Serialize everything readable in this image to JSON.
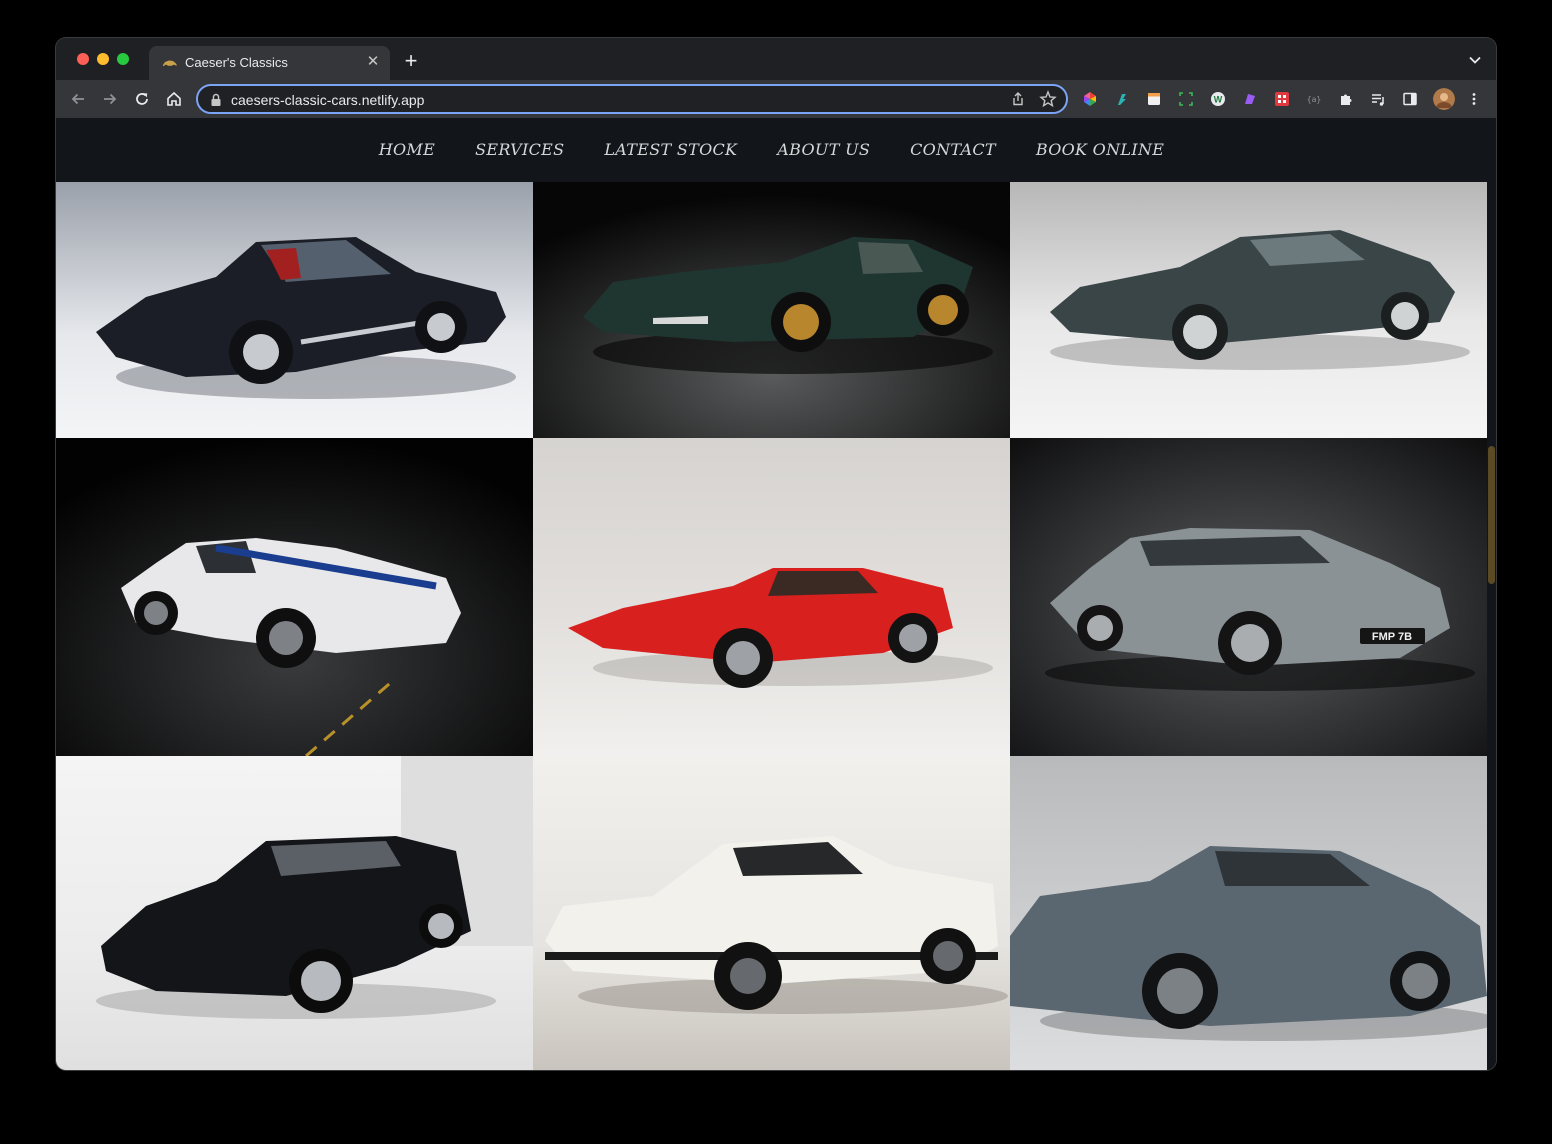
{
  "browser": {
    "tab_title": "Caeser's Classics",
    "tab_close": "✕",
    "new_tab": "+",
    "url": "caesers-classic-cars.netlify.app",
    "accent_color": "#7ca4f5"
  },
  "nav": {
    "items": [
      {
        "label": "HOME"
      },
      {
        "label": "SERVICES"
      },
      {
        "label": "LATEST STOCK"
      },
      {
        "label": "ABOUT US"
      },
      {
        "label": "CONTACT"
      },
      {
        "label": "BOOK ONLINE"
      }
    ]
  },
  "gallery": {
    "cars": [
      {
        "name": "black-coupe-split-window",
        "bg": "#d8dbe0",
        "body": "#1b1e27"
      },
      {
        "name": "dark-green-mid-engine",
        "bg": "#1a1b1c",
        "body": "#1f3530"
      },
      {
        "name": "grey-green-e-type",
        "bg": "#e6e6e6",
        "body": "#3a4548"
      },
      {
        "name": "white-striped-muscle-car",
        "bg": "#0b0b0c",
        "body": "#e8e8ea"
      },
      {
        "name": "red-ferrari-308",
        "bg": "#dcdad8",
        "body": "#d8201e"
      },
      {
        "name": "silver-aston-db5",
        "bg": "#2b2b2d",
        "body": "#8a9296"
      },
      {
        "name": "black-xjs-coupe",
        "bg": "#efefef",
        "body": "#141518"
      },
      {
        "name": "white-911-turbo",
        "bg": "#e6e4e0",
        "body": "#f2f1ec"
      },
      {
        "name": "grey-aston-db4",
        "bg": "#c9cacc",
        "body": "#5a6670"
      }
    ],
    "plate_text": "FMP 7B"
  }
}
